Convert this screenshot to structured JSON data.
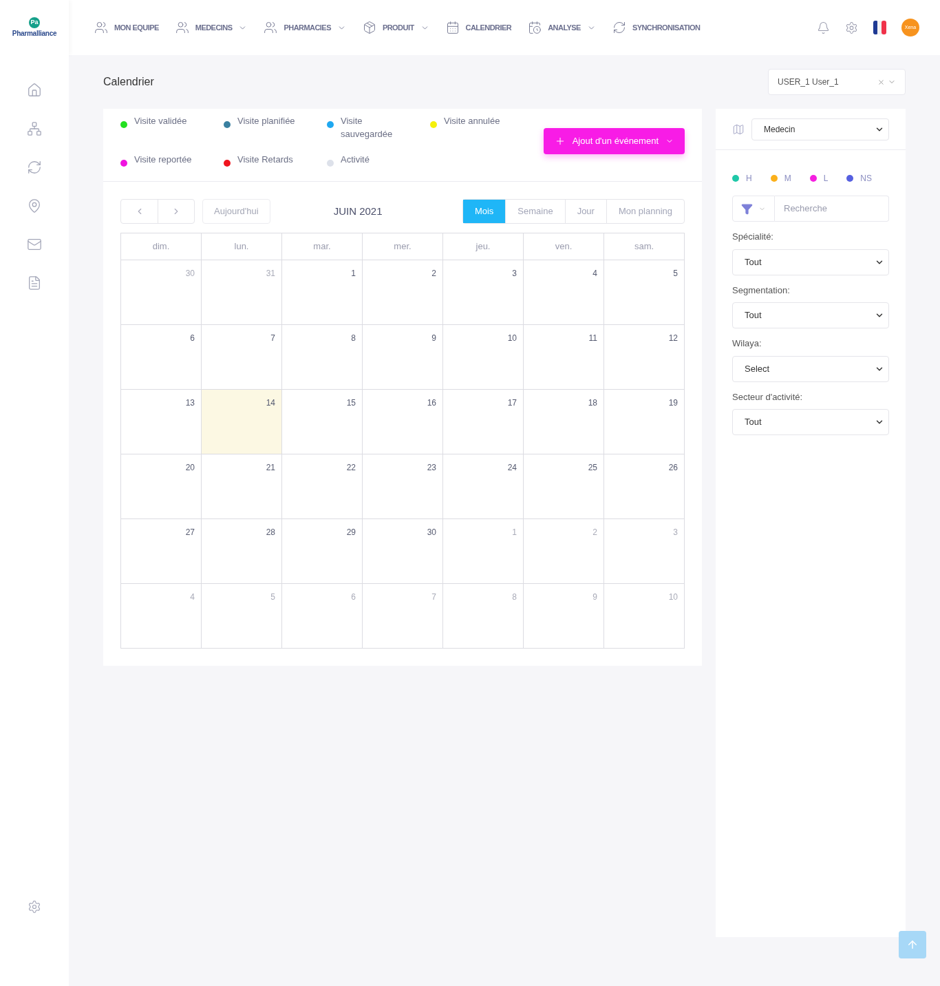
{
  "logo": {
    "mark": "Pa",
    "name": "Pharmalliance"
  },
  "nav": [
    {
      "label": "MON EQUIPE",
      "dropdown": false
    },
    {
      "label": "MEDECINS",
      "dropdown": true
    },
    {
      "label": "PHARMACIES",
      "dropdown": true
    },
    {
      "label": "PRODUIT",
      "dropdown": true
    },
    {
      "label": "CALENDRIER",
      "dropdown": false
    },
    {
      "label": "ANALYSE",
      "dropdown": true
    },
    {
      "label": "SYNCHRONISATION",
      "dropdown": false
    }
  ],
  "avatar": {
    "text": "Xena"
  },
  "page_title": "Calendrier",
  "user_select": {
    "value": "USER_1 User_1"
  },
  "legend": [
    {
      "label": "Visite validée",
      "color": "#22e01f"
    },
    {
      "label": "Visite planifiée",
      "color": "#3a80a0"
    },
    {
      "label": "Visite sauvegardée",
      "color": "#1fa8f0"
    },
    {
      "label": "Visite annulée",
      "color": "#f5f00a"
    },
    {
      "label": "Visite reportée",
      "color": "#f014e0"
    },
    {
      "label": "Visite Retards",
      "color": "#f0141e"
    },
    {
      "label": "Activité",
      "color": "#dde1ea"
    }
  ],
  "add_button": {
    "label": "Ajout d'un événement"
  },
  "today_button": {
    "label": "Aujourd'hui",
    "disabled": true
  },
  "month_title": "JUIN 2021",
  "views": [
    {
      "label": "Mois",
      "selected": true
    },
    {
      "label": "Semaine",
      "selected": false
    },
    {
      "label": "Jour",
      "selected": false
    },
    {
      "label": "Mon planning",
      "selected": false
    }
  ],
  "weekdays": [
    "dim.",
    "lun.",
    "mar.",
    "mer.",
    "jeu.",
    "ven.",
    "sam."
  ],
  "weeks": [
    [
      {
        "day": "30",
        "other_month": true,
        "today": false
      },
      {
        "day": "31",
        "other_month": true,
        "today": false
      },
      {
        "day": "1",
        "other_month": false,
        "today": false
      },
      {
        "day": "2",
        "other_month": false,
        "today": false
      },
      {
        "day": "3",
        "other_month": false,
        "today": false
      },
      {
        "day": "4",
        "other_month": false,
        "today": false
      },
      {
        "day": "5",
        "other_month": false,
        "today": false
      }
    ],
    [
      {
        "day": "6",
        "other_month": false,
        "today": false
      },
      {
        "day": "7",
        "other_month": false,
        "today": false
      },
      {
        "day": "8",
        "other_month": false,
        "today": false
      },
      {
        "day": "9",
        "other_month": false,
        "today": false
      },
      {
        "day": "10",
        "other_month": false,
        "today": false
      },
      {
        "day": "11",
        "other_month": false,
        "today": false
      },
      {
        "day": "12",
        "other_month": false,
        "today": false
      }
    ],
    [
      {
        "day": "13",
        "other_month": false,
        "today": false
      },
      {
        "day": "14",
        "other_month": false,
        "today": true
      },
      {
        "day": "15",
        "other_month": false,
        "today": false
      },
      {
        "day": "16",
        "other_month": false,
        "today": false
      },
      {
        "day": "17",
        "other_month": false,
        "today": false
      },
      {
        "day": "18",
        "other_month": false,
        "today": false
      },
      {
        "day": "19",
        "other_month": false,
        "today": false
      }
    ],
    [
      {
        "day": "20",
        "other_month": false,
        "today": false
      },
      {
        "day": "21",
        "other_month": false,
        "today": false
      },
      {
        "day": "22",
        "other_month": false,
        "today": false
      },
      {
        "day": "23",
        "other_month": false,
        "today": false
      },
      {
        "day": "24",
        "other_month": false,
        "today": false
      },
      {
        "day": "25",
        "other_month": false,
        "today": false
      },
      {
        "day": "26",
        "other_month": false,
        "today": false
      }
    ],
    [
      {
        "day": "27",
        "other_month": false,
        "today": false
      },
      {
        "day": "28",
        "other_month": false,
        "today": false
      },
      {
        "day": "29",
        "other_month": false,
        "today": false
      },
      {
        "day": "30",
        "other_month": false,
        "today": false
      },
      {
        "day": "1",
        "other_month": true,
        "today": false
      },
      {
        "day": "2",
        "other_month": true,
        "today": false
      },
      {
        "day": "3",
        "other_month": true,
        "today": false
      }
    ],
    [
      {
        "day": "4",
        "other_month": true,
        "today": false
      },
      {
        "day": "5",
        "other_month": true,
        "today": false
      },
      {
        "day": "6",
        "other_month": true,
        "today": false
      },
      {
        "day": "7",
        "other_month": true,
        "today": false
      },
      {
        "day": "8",
        "other_month": true,
        "today": false
      },
      {
        "day": "9",
        "other_month": true,
        "today": false
      },
      {
        "day": "10",
        "other_month": true,
        "today": false
      }
    ]
  ],
  "side_panel": {
    "type_select": "Medecin",
    "levels": [
      {
        "label": "H",
        "color": "#1fc8a8"
      },
      {
        "label": "M",
        "color": "#fbb01a"
      },
      {
        "label": "L",
        "color": "#f51fe0"
      },
      {
        "label": "NS",
        "color": "#5660e0"
      }
    ],
    "search": {
      "placeholder": "Recherche"
    },
    "filters": [
      {
        "label": "Spécialité:",
        "value": "Tout"
      },
      {
        "label": "Segmentation:",
        "value": "Tout"
      },
      {
        "label": "Wilaya:",
        "value": "Select"
      },
      {
        "label": "Secteur d'activité:",
        "value": "Tout"
      }
    ]
  }
}
